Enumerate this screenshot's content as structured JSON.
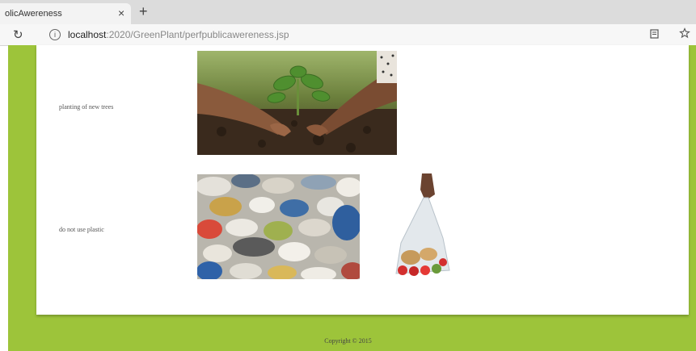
{
  "browser": {
    "tab_title": "olicAwereness",
    "tab_close": "×",
    "new_tab": "+",
    "refresh": "↻",
    "info": "i",
    "url_host": "localhost",
    "url_path": ":2020/GreenPlant/perfpublicawereness.jsp",
    "reader_icon": "reader-mode-icon",
    "favorite_icon": "star-icon"
  },
  "colors": {
    "page_background": "#9dc43a",
    "card_background": "#ffffff"
  },
  "rows": [
    {
      "label": "planting of new trees",
      "image": "hands planting a seedling in soil"
    },
    {
      "label": "do not use plastic",
      "images": [
        "pile of plastic waste",
        "hand holding plastic bag of vegetables"
      ]
    }
  ],
  "footer": {
    "copyright": "Copyright © 2015"
  }
}
